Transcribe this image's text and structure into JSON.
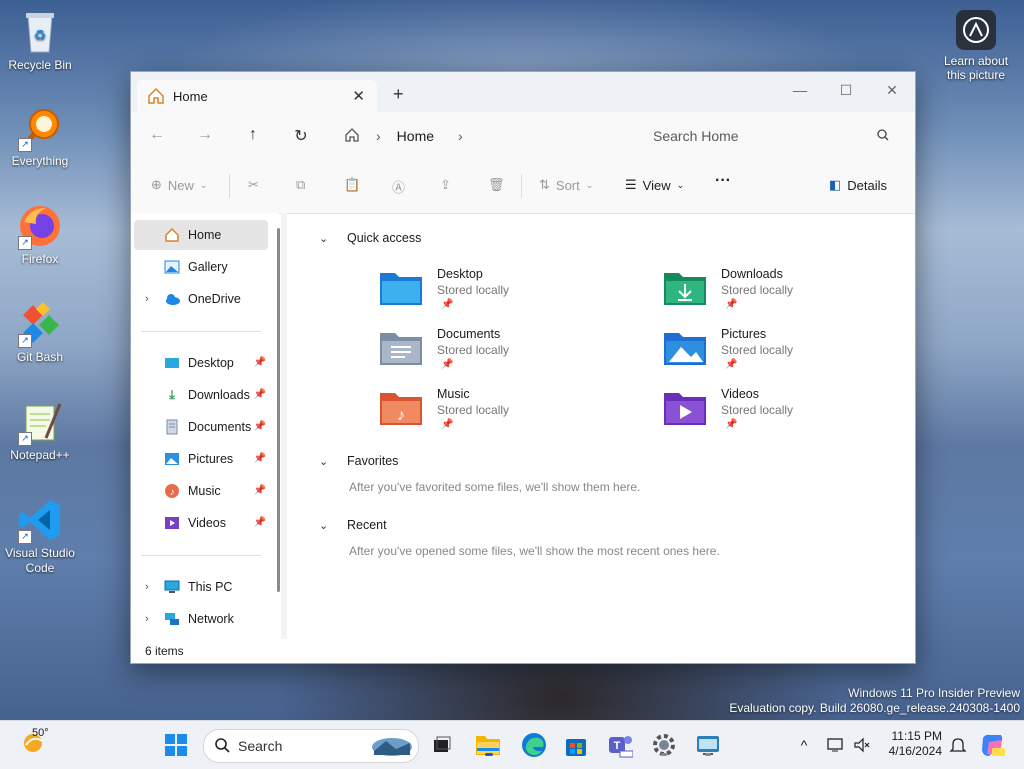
{
  "desktop": {
    "icons": [
      {
        "label": "Recycle Bin",
        "icon": "recycle-bin-icon"
      },
      {
        "label": "Everything",
        "icon": "everything-search-icon"
      },
      {
        "label": "Firefox",
        "icon": "firefox-icon"
      },
      {
        "label": "Git Bash",
        "icon": "git-bash-icon"
      },
      {
        "label": "Notepad++",
        "icon": "notepadpp-icon"
      },
      {
        "label": "Visual Studio Code",
        "icon": "vscode-icon"
      }
    ],
    "learn_label": "Learn about this picture",
    "watermark_line1": "Windows 11 Pro Insider Preview",
    "watermark_line2": "Evaluation copy. Build 26080.ge_release.240308-1400"
  },
  "explorer": {
    "tab_title": "Home",
    "breadcrumb": "Home",
    "search_placeholder": "Search Home",
    "commands": {
      "new": "New",
      "sort": "Sort",
      "view": "View",
      "details": "Details"
    },
    "sidebar": {
      "home": "Home",
      "gallery": "Gallery",
      "onedrive": "OneDrive",
      "desktop": "Desktop",
      "downloads": "Downloads",
      "documents": "Documents",
      "pictures": "Pictures",
      "music": "Music",
      "videos": "Videos",
      "thispc": "This PC",
      "network": "Network"
    },
    "quick_access_title": "Quick access",
    "quick_access": [
      {
        "name": "Desktop",
        "sub": "Stored locally"
      },
      {
        "name": "Downloads",
        "sub": "Stored locally"
      },
      {
        "name": "Documents",
        "sub": "Stored locally"
      },
      {
        "name": "Pictures",
        "sub": "Stored locally"
      },
      {
        "name": "Music",
        "sub": "Stored locally"
      },
      {
        "name": "Videos",
        "sub": "Stored locally"
      }
    ],
    "favorites_title": "Favorites",
    "favorites_msg": "After you've favorited some files, we'll show them here.",
    "recent_title": "Recent",
    "recent_msg": "After you've opened some files, we'll show the most recent ones here.",
    "status": "6 items"
  },
  "taskbar": {
    "weather": "50°",
    "search_placeholder": "Search",
    "time": "11:15 PM",
    "date": "4/16/2024"
  }
}
